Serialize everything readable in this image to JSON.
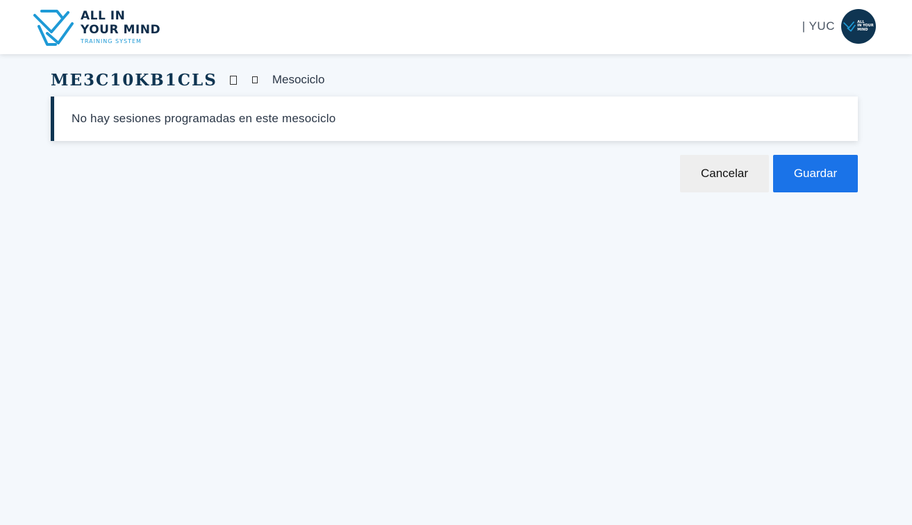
{
  "brand": {
    "line1": "ALL IN",
    "line2": "YOUR MIND",
    "subtitle": "TRAINING SYSTEM",
    "primary_color": "#0f2d4a",
    "accent_color": "#1e9ad6"
  },
  "user": {
    "label": "| YUC",
    "avatar_line1": "ALL",
    "avatar_line2": "IN YOUR",
    "avatar_line3": "MIND"
  },
  "page": {
    "title": "ME3C10KB1CLS",
    "title_icon_1": "square-icon",
    "title_icon_2": "square-icon",
    "breadcrumb": "Mesociclo"
  },
  "notice": {
    "text": "No hay sesiones programadas en este mesociclo"
  },
  "actions": {
    "cancel_label": "Cancelar",
    "save_label": "Guardar",
    "save_color": "#1a73e8"
  }
}
